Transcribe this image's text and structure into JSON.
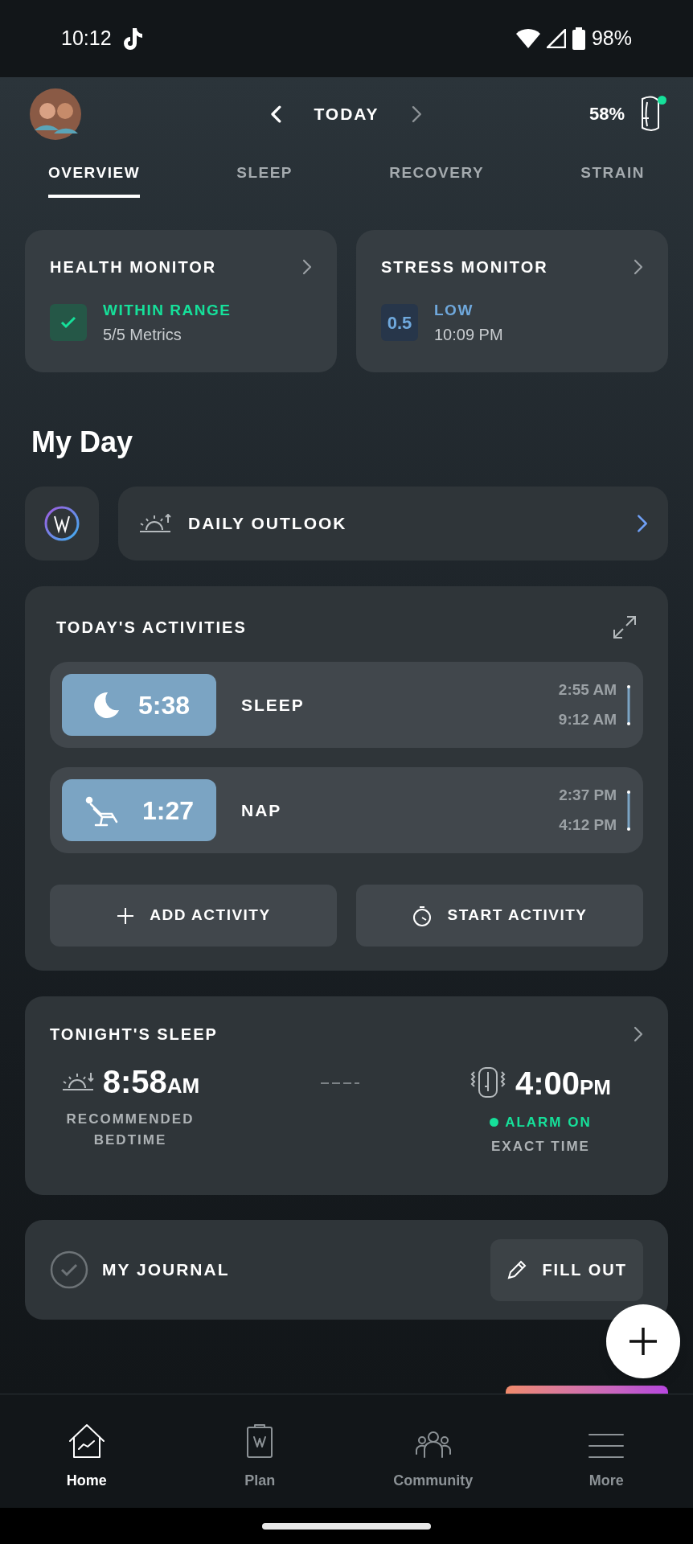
{
  "status_bar": {
    "time": "10:12",
    "battery": "98%"
  },
  "header": {
    "date_label": "TODAY",
    "device_battery": "58%",
    "device_connected": true
  },
  "tabs": [
    {
      "label": "OVERVIEW",
      "selected": true
    },
    {
      "label": "SLEEP",
      "selected": false
    },
    {
      "label": "RECOVERY",
      "selected": false
    },
    {
      "label": "STRAIN",
      "selected": false
    }
  ],
  "monitors": [
    {
      "title": "HEALTH MONITOR",
      "kind": "check",
      "status": "WITHIN RANGE",
      "detail": "5/5 Metrics"
    },
    {
      "title": "STRESS MONITOR",
      "kind": "score",
      "score": "0.5",
      "status": "LOW",
      "detail": "10:09 PM"
    }
  ],
  "my_day": {
    "title": "My Day",
    "daily_outlook": "DAILY OUTLOOK"
  },
  "activities": {
    "title": "TODAY'S ACTIVITIES",
    "items": [
      {
        "kind": "sleep",
        "duration": "5:38",
        "name": "SLEEP",
        "start": "2:55 AM",
        "end": "9:12 AM"
      },
      {
        "kind": "nap",
        "duration": "1:27",
        "name": "NAP",
        "start": "2:37 PM",
        "end": "4:12 PM"
      }
    ],
    "buttons": [
      {
        "kind": "add",
        "label": "ADD ACTIVITY"
      },
      {
        "kind": "start",
        "label": "START ACTIVITY"
      }
    ]
  },
  "tonights_sleep": {
    "title": "TONIGHT'S SLEEP",
    "bedtime": {
      "time": "8:58",
      "period": "AM",
      "label": "RECOMMENDED BEDTIME"
    },
    "alarm": {
      "time": "4:00",
      "period": "PM",
      "on": true,
      "status": "ALARM ON",
      "mode": "EXACT TIME"
    }
  },
  "journal": {
    "title": "MY JOURNAL",
    "checked": false,
    "button": "FILL OUT"
  },
  "nav": [
    {
      "kind": "home",
      "label": "Home",
      "selected": true
    },
    {
      "kind": "plan",
      "label": "Plan",
      "selected": false
    },
    {
      "kind": "community",
      "label": "Community",
      "selected": false
    },
    {
      "kind": "more",
      "label": "More",
      "selected": false
    }
  ]
}
